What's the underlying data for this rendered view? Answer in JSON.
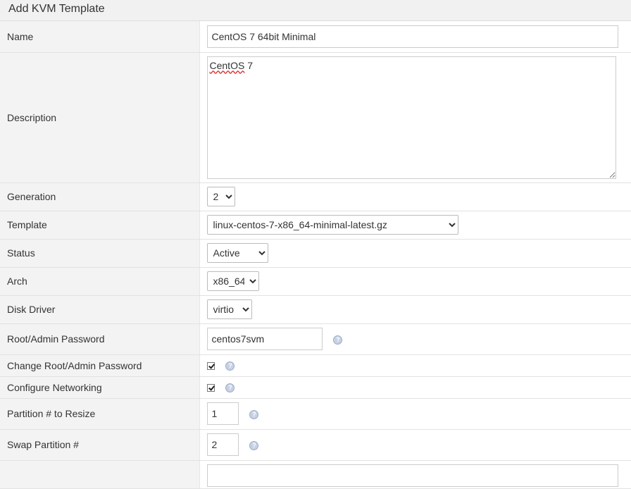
{
  "page": {
    "title": "Add KVM Template"
  },
  "form": {
    "name": {
      "label": "Name",
      "value": "CentOS 7 64bit Minimal"
    },
    "description": {
      "label": "Description",
      "value_word1": "CentOS",
      "value_word2": " 7"
    },
    "generation": {
      "label": "Generation",
      "selected": "2"
    },
    "template": {
      "label": "Template",
      "selected": "linux-centos-7-x86_64-minimal-latest.gz"
    },
    "status": {
      "label": "Status",
      "selected": "Active"
    },
    "arch": {
      "label": "Arch",
      "selected": "x86_64"
    },
    "disk_driver": {
      "label": "Disk Driver",
      "selected": "virtio"
    },
    "root_password": {
      "label": "Root/Admin Password",
      "value": "centos7svm"
    },
    "change_root_password": {
      "label": "Change Root/Admin Password",
      "checked": true
    },
    "configure_networking": {
      "label": "Configure Networking",
      "checked": true
    },
    "partition_resize": {
      "label": "Partition # to Resize",
      "value": "1"
    },
    "swap_partition": {
      "label": "Swap Partition #",
      "value": "2"
    }
  },
  "icons": {
    "help": "question-circle-icon",
    "checkbox": "check-icon"
  },
  "colors": {
    "label_bg": "#f3f3f3",
    "help_icon": "#c7d1e4"
  }
}
